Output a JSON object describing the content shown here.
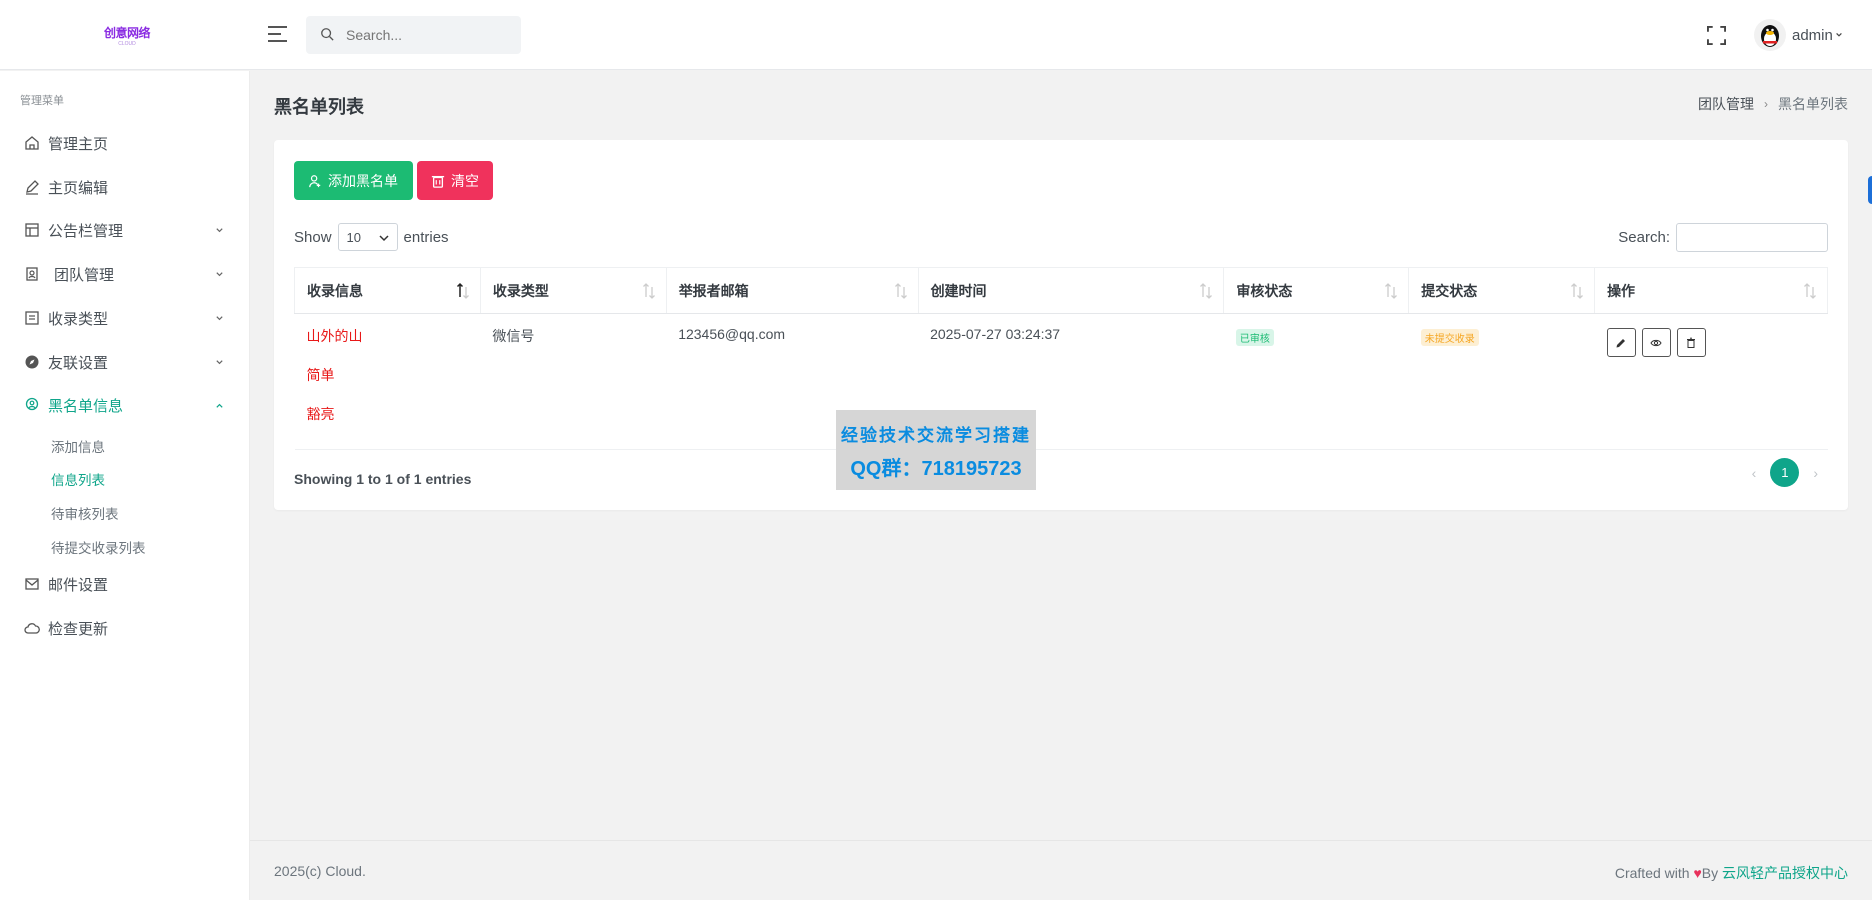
{
  "brand": {
    "logo_text": "创意网络",
    "logo_sub": "CLOUD"
  },
  "header": {
    "search_placeholder": "Search...",
    "username": "admin"
  },
  "sidebar": {
    "menu_title": "管理菜单",
    "items": [
      {
        "label": "管理主页",
        "icon": "home-icon"
      },
      {
        "label": "主页编辑",
        "icon": "edit-icon"
      },
      {
        "label": "公告栏管理",
        "icon": "notice-icon"
      },
      {
        "label": "团队管理",
        "icon": "team-icon"
      },
      {
        "label": "收录类型",
        "icon": "list-icon"
      },
      {
        "label": "友联设置",
        "icon": "compass-icon"
      },
      {
        "label": "黑名单信息",
        "icon": "blacklist-icon"
      },
      {
        "label": "邮件设置",
        "icon": "mail-icon"
      },
      {
        "label": "检查更新",
        "icon": "cloud-icon"
      }
    ],
    "sub_items": [
      "添加信息",
      "信息列表",
      "待审核列表",
      "待提交收录列表"
    ]
  },
  "page": {
    "title": "黑名单列表",
    "breadcrumb": [
      "团队管理",
      "黑名单列表"
    ]
  },
  "toolbar": {
    "add_label": "添加黑名单",
    "clear_label": "清空"
  },
  "table_controls": {
    "show_label": "Show",
    "page_length": "10",
    "entries_label": "entries",
    "search_label": "Search:"
  },
  "table": {
    "columns": [
      "收录信息",
      "收录类型",
      "举报者邮箱",
      "创建时间",
      "审核状态",
      "提交状态",
      "操作"
    ],
    "rows": [
      {
        "info": [
          "山外的山",
          "简单",
          "豁亮"
        ],
        "type": "微信号",
        "email": "123456@qq.com",
        "created": "2025-07-27 03:24:37",
        "review_status": "已审核",
        "submit_status": "未提交收录"
      }
    ]
  },
  "pagination": {
    "info": "Showing 1 to 1 of 1 entries",
    "current_page": "1",
    "prev": "‹",
    "next": "›"
  },
  "watermark": {
    "line1": "经验技术交流学习搭建",
    "line2": "QQ群：718195723"
  },
  "footer": {
    "copyright": "2025(c) Cloud.",
    "crafted": "Crafted with",
    "by": "By",
    "link": "云风轻产品授权中心"
  },
  "colors": {
    "accent": "#0fa58a",
    "success": "#1cbb73",
    "danger": "#f0325c",
    "highlight_text": "#e81818"
  }
}
